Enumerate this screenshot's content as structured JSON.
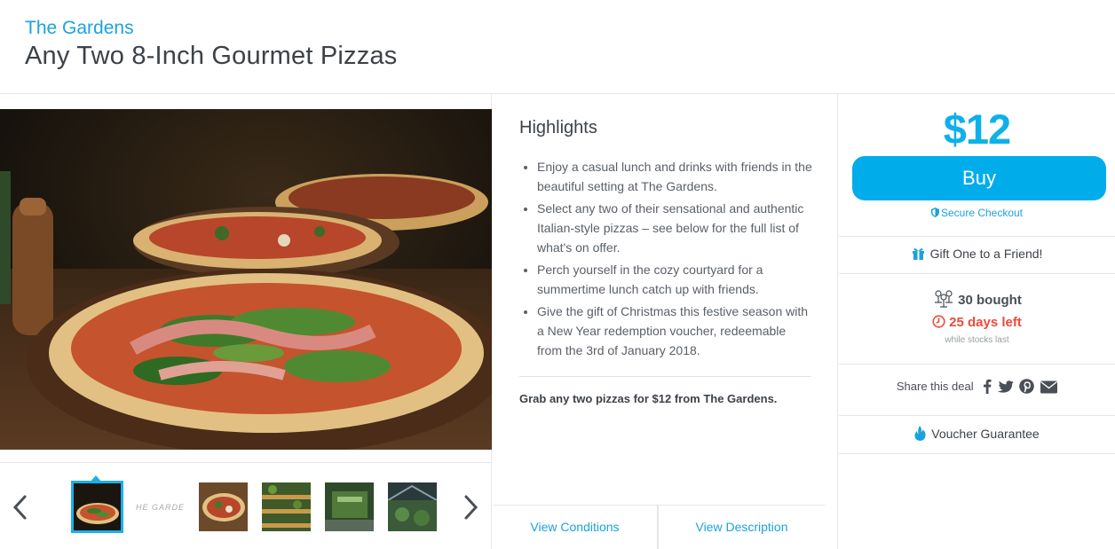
{
  "header": {
    "merchant": "The Gardens",
    "title": "Any Two 8-Inch Gourmet Pizzas"
  },
  "gallery": {
    "prev_icon": "chevron-left-icon",
    "next_icon": "chevron-right-icon",
    "thumb_text": "HE GARDE?"
  },
  "highlights": {
    "heading": "Highlights",
    "items": [
      "Enjoy a casual lunch and drinks with friends in the beautiful setting at The Gardens.",
      "Select any two of their sensational and authentic Italian-style pizzas – see below for the full list of what's on offer.",
      "Perch yourself in the cozy courtyard for a summertime lunch catch up with friends.",
      "Give the gift of Christmas this festive season with a New Year redemption voucher, redeemable from the 3rd of January 2018."
    ],
    "summary": "Grab any two pizzas for $12 from The Gardens.",
    "tabs": [
      "View Conditions",
      "View Description"
    ]
  },
  "buybox": {
    "price": "$12",
    "buy_label": "Buy",
    "secure_label": "Secure Checkout",
    "gift_label": "Gift One to a Friend!",
    "bought_label": "30 bought",
    "days_left_label": "25 days left",
    "stock_note": "while stocks last",
    "share_label": "Share this deal",
    "share_icons": [
      "facebook-icon",
      "twitter-icon",
      "pinterest-icon",
      "email-icon"
    ],
    "guarantee_label": "Voucher Guarantee"
  },
  "colors": {
    "accent": "#00adea",
    "link": "#1aa3db",
    "alert": "#ee4a3b",
    "text": "#3c4248"
  }
}
